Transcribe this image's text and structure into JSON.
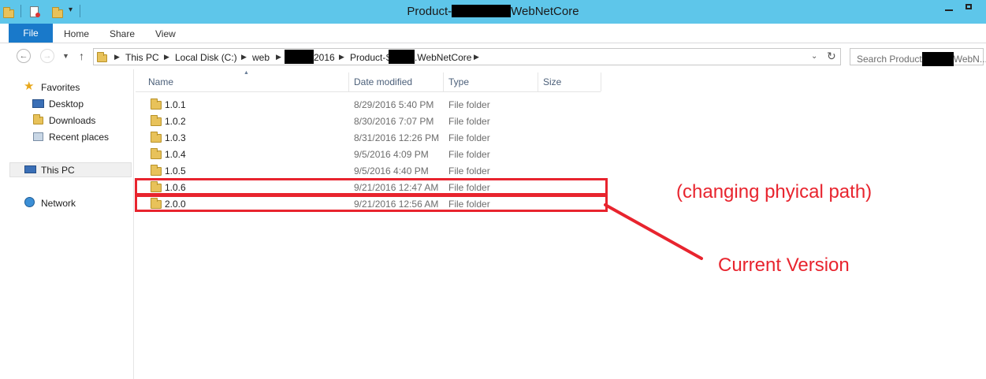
{
  "window": {
    "title_prefix": "Product-",
    "title_suffix": "WebNetCore"
  },
  "ribbon": {
    "tabs": [
      "File",
      "Home",
      "Share",
      "View"
    ]
  },
  "address": {
    "crumbs": [
      "This PC",
      "Local Disk (C:)",
      "web",
      "2016",
      "Product-S",
      ".WebNetCore"
    ]
  },
  "search": {
    "prefix": "Search Product",
    "suffix": "WebN..."
  },
  "nav": {
    "favorites": "Favorites",
    "desktop": "Desktop",
    "downloads": "Downloads",
    "recent": "Recent places",
    "thispc": "This PC",
    "network": "Network"
  },
  "columns": {
    "name": "Name",
    "date": "Date modified",
    "type": "Type",
    "size": "Size"
  },
  "rows": [
    {
      "name": "1.0.1",
      "date": "8/29/2016 5:40 PM",
      "type": "File folder"
    },
    {
      "name": "1.0.2",
      "date": "8/30/2016 7:07 PM",
      "type": "File folder"
    },
    {
      "name": "1.0.3",
      "date": "8/31/2016 12:26 PM",
      "type": "File folder"
    },
    {
      "name": "1.0.4",
      "date": "9/5/2016 4:09 PM",
      "type": "File folder"
    },
    {
      "name": "1.0.5",
      "date": "9/5/2016 4:40 PM",
      "type": "File folder"
    },
    {
      "name": "1.0.6",
      "date": "9/21/2016 12:47 AM",
      "type": "File folder"
    },
    {
      "name": "2.0.0",
      "date": "9/21/2016 12:56 AM",
      "type": "File folder"
    }
  ],
  "annotations": {
    "changing": "(changing phyical path)",
    "current": "Current Version"
  },
  "colors": {
    "titlebar": "#5ec6ea",
    "file_tab": "#1979ca",
    "annotation_red": "#e8242e",
    "folder": "#e8c25a"
  }
}
